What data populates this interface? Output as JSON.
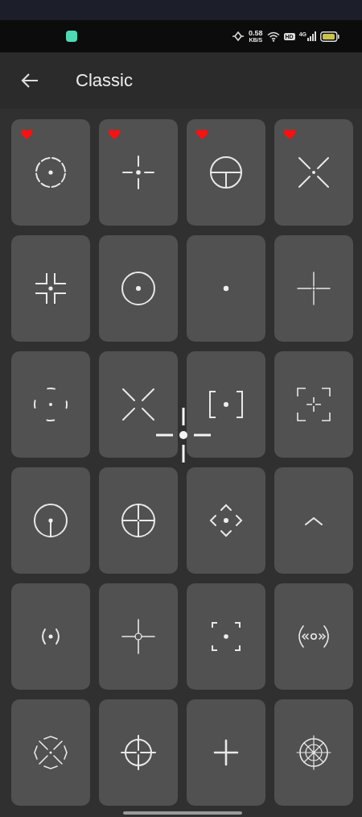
{
  "status_bar": {
    "net_speed": "0.58",
    "net_unit": "KB/S",
    "hd": "HD",
    "network": "4G"
  },
  "app_bar": {
    "title": "Classic"
  },
  "tiles": [
    {
      "kind": "dashed-circle-dot",
      "favorite": true
    },
    {
      "kind": "cross-dot",
      "favorite": true
    },
    {
      "kind": "circle-tee",
      "favorite": true
    },
    {
      "kind": "x-dot",
      "favorite": true
    },
    {
      "kind": "corner-brackets-dot",
      "favorite": false
    },
    {
      "kind": "circle-dot",
      "favorite": false
    },
    {
      "kind": "dot",
      "favorite": false
    },
    {
      "kind": "thin-cross",
      "favorite": false
    },
    {
      "kind": "broken-circle-dot",
      "favorite": false
    },
    {
      "kind": "x",
      "favorite": false
    },
    {
      "kind": "square-brackets-dot",
      "favorite": false
    },
    {
      "kind": "frame-cross",
      "favorite": false
    },
    {
      "kind": "circle-post",
      "favorite": false
    },
    {
      "kind": "circle-cross",
      "favorite": false
    },
    {
      "kind": "diamond-chevrons-dot",
      "favorite": false
    },
    {
      "kind": "chevron",
      "favorite": false
    },
    {
      "kind": "parens-dot",
      "favorite": false
    },
    {
      "kind": "cross-ring",
      "favorite": false
    },
    {
      "kind": "frame-corners-dot",
      "favorite": false
    },
    {
      "kind": "bracket-ring",
      "favorite": false
    },
    {
      "kind": "octagon-x",
      "favorite": false
    },
    {
      "kind": "circle-cross-ticks",
      "favorite": false
    },
    {
      "kind": "plus",
      "favorite": false
    },
    {
      "kind": "web",
      "favorite": false
    }
  ]
}
